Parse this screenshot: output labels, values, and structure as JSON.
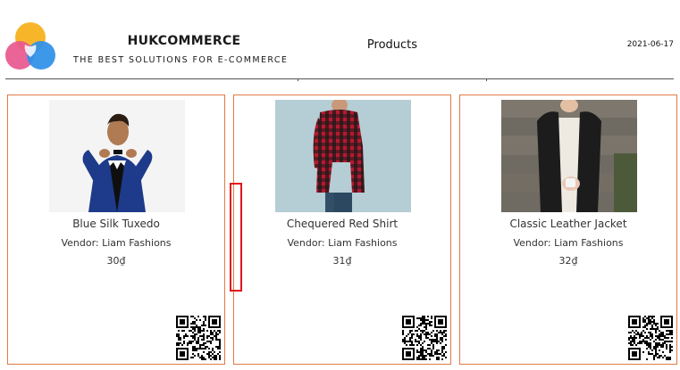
{
  "header": {
    "brand_name": "HUKCOMMERCE",
    "tagline": "THE BEST SOLUTIONS FOR E-COMMERCE",
    "page_title": "Products",
    "date": "2021-06-17"
  },
  "colors": {
    "card_border": "#e07a45",
    "highlight": "#e0151b",
    "logo_yellow": "#f7b62a",
    "logo_pink": "#e8578f",
    "logo_blue": "#2e8fe8"
  },
  "products": [
    {
      "name": "Blue Silk Tuxedo",
      "vendor": "Vendor: Liam Fashions",
      "price": "30₫",
      "image": "man-in-blue-tuxedo-photo",
      "qr": "qr-code-icon"
    },
    {
      "name": "Chequered Red Shirt",
      "vendor": "Vendor: Liam Fashions",
      "price": "31₫",
      "image": "man-in-red-checkered-shirt-photo",
      "qr": "qr-code-icon"
    },
    {
      "name": "Classic Leather Jacket",
      "vendor": "Vendor: Liam Fashions",
      "price": "32₫",
      "image": "woman-in-leather-jacket-photo",
      "qr": "qr-code-icon"
    }
  ]
}
